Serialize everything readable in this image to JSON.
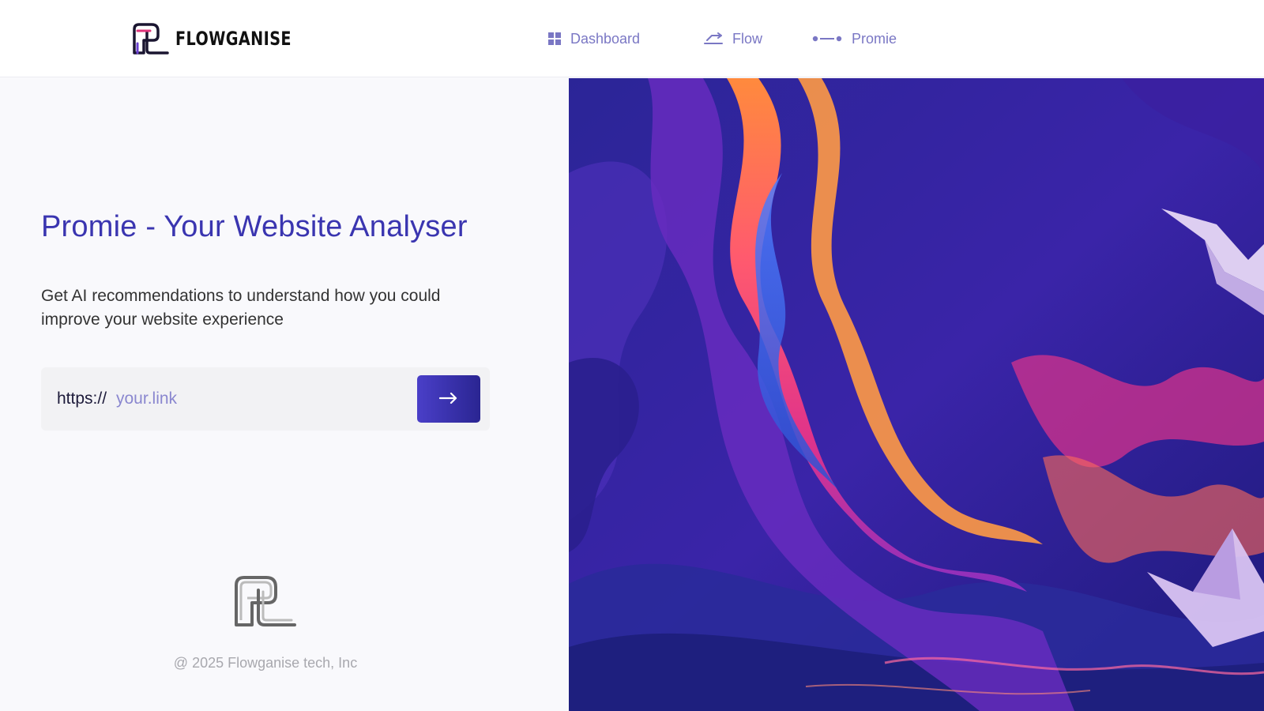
{
  "brand": {
    "name": "FLOWGANISE",
    "logo_icon": "flowganise-logo-icon"
  },
  "nav": {
    "items": [
      {
        "label": "Dashboard",
        "icon": "grid-icon"
      },
      {
        "label": "Flow",
        "icon": "flow-arrow-icon"
      },
      {
        "label": "Promie",
        "icon": "dots-line-icon"
      }
    ],
    "color": "#7a77c4"
  },
  "hero": {
    "title": "Promie - Your Website Analyser",
    "subtitle": "Get AI recommendations to understand how you could improve your website experience"
  },
  "url_form": {
    "prefix": "https://",
    "placeholder": "your.link",
    "value": "",
    "submit_icon": "arrow-right-icon"
  },
  "footer": {
    "copyright": "@ 2025 Flowganise tech, Inc",
    "logo_icon": "flowganise-logo-outline-icon"
  },
  "artwork": {
    "description_icon": "abstract-wave-painting"
  },
  "colors": {
    "accent": "#3a35b0",
    "button_start": "#4a3fc8",
    "button_end": "#2a2592",
    "background": "#f9f9fc"
  }
}
